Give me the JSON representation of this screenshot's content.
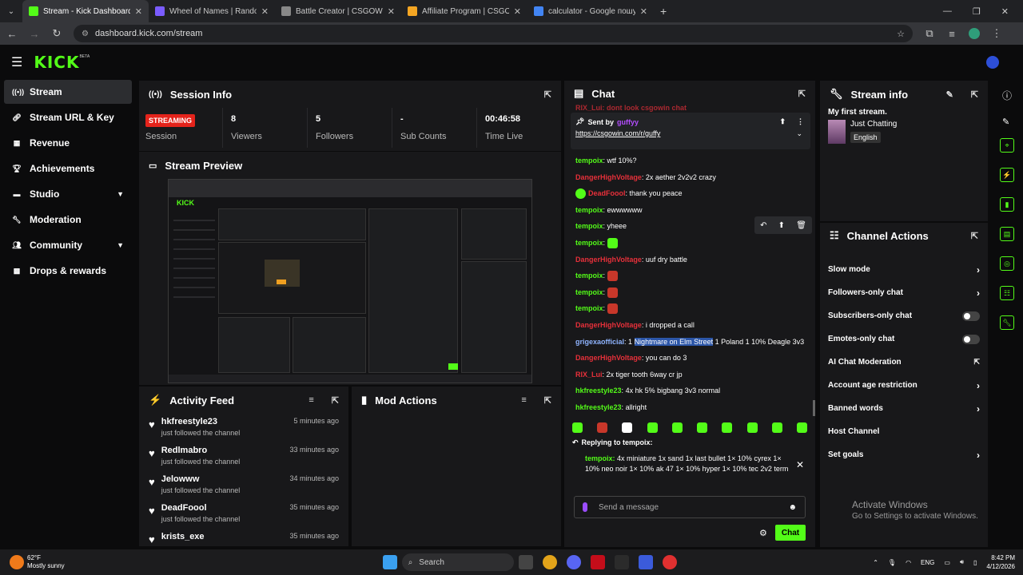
{
  "browser": {
    "tabs": [
      {
        "title": "Stream - Kick Dashboard",
        "active": true,
        "fav": "#53fc18"
      },
      {
        "title": "Wheel of Names | Random nam",
        "active": false,
        "fav": "#7a5cff"
      },
      {
        "title": "Battle Creator | CSGOWIN | De",
        "active": false,
        "fav": "#888888"
      },
      {
        "title": "Affiliate Program | CSGOWIN |",
        "active": false,
        "fav": "#f5a623"
      },
      {
        "title": "calculator - Google пошук",
        "active": false,
        "fav": "#4285f4"
      }
    ],
    "url": "dashboard.kick.com/stream"
  },
  "sidebar": {
    "items": [
      {
        "label": "Stream",
        "icon": "signal-icon"
      },
      {
        "label": "Stream URL & Key",
        "icon": "link-icon"
      },
      {
        "label": "Revenue",
        "icon": "revenue-icon"
      },
      {
        "label": "Achievements",
        "icon": "trophy-icon"
      },
      {
        "label": "Studio",
        "icon": "studio-icon"
      },
      {
        "label": "Moderation",
        "icon": "wrench-icon"
      },
      {
        "label": "Community",
        "icon": "users-icon"
      },
      {
        "label": "Drops & rewards",
        "icon": "gift-icon"
      }
    ]
  },
  "session": {
    "title": "Session Info",
    "badge": "STREAMING",
    "session_label": "Session",
    "stats": [
      {
        "value": "8",
        "label": "Viewers"
      },
      {
        "value": "5",
        "label": "Followers"
      },
      {
        "value": "-",
        "label": "Sub Counts"
      },
      {
        "value": "00:46:58",
        "label": "Time Live"
      }
    ]
  },
  "preview": {
    "title": "Stream Preview"
  },
  "activity": {
    "title": "Activity Feed",
    "items": [
      {
        "name": "hkfreestyle23",
        "sub": "just followed the channel",
        "time": "5 minutes ago"
      },
      {
        "name": "Redlmabro",
        "sub": "just followed the channel",
        "time": "33 minutes ago"
      },
      {
        "name": "Jelowww",
        "sub": "just followed the channel",
        "time": "34 minutes ago"
      },
      {
        "name": "DeadFoool",
        "sub": "just followed the channel",
        "time": "35 minutes ago"
      },
      {
        "name": "krists_exe",
        "sub": "",
        "time": "35 minutes ago"
      }
    ]
  },
  "mod": {
    "title": "Mod Actions"
  },
  "chat": {
    "title": "Chat",
    "cut": "RIX_Lui: dont look csgowin chat",
    "pinned_label": "Sent by",
    "pinned_user": "guffyy",
    "pinned_link": "https://csgowin.com/r/guffy",
    "messages": [
      {
        "user": "tempoix",
        "color": "g",
        "text": "wtf 10%?"
      },
      {
        "user": "DangerHighVoltage",
        "color": "r",
        "text": "2x aether 2v2v2 crazy"
      },
      {
        "user": "DeadFoool",
        "color": "r",
        "text": "thank you peace"
      },
      {
        "user": "tempoix",
        "color": "g",
        "text": "ewwwwww"
      },
      {
        "user": "tempoix",
        "color": "g",
        "text": "yheee"
      },
      {
        "user": "tempoix",
        "color": "g",
        "text": ""
      },
      {
        "user": "DangerHighVoltage",
        "color": "r",
        "text": "uuf dry battle"
      },
      {
        "user": "tempoix",
        "color": "g",
        "text": ""
      },
      {
        "user": "tempoix",
        "color": "g",
        "text": ""
      },
      {
        "user": "tempoix",
        "color": "g",
        "text": ""
      },
      {
        "user": "DangerHighVoltage",
        "color": "r",
        "text": "i dropped a call"
      },
      {
        "user": "grigexaofficial",
        "color": "b",
        "text": "1 Nightmare on Elm Street 1 Poland 1 10% Deagle 3v3"
      },
      {
        "user": "DangerHighVoltage",
        "color": "r",
        "text": "you can do 3"
      },
      {
        "user": "RIX_Lui",
        "color": "r",
        "text": "2x tiger tooth 6way cr jp"
      },
      {
        "user": "hkfreestyle23",
        "color": "g",
        "text": "4x hk 5% bigbang 3v3 normal"
      },
      {
        "user": "hkfreestyle23",
        "color": "g",
        "text": "allright"
      }
    ],
    "reply_label": "Replying to tempoix:",
    "reply_user": "tempoix",
    "reply_text": "4x miniature 1x sand 1x last bullet 1× 10% cyrex 1× 10% neo noir 1× 10% ak 47 1× 10% hyper 1× 10% tec 2v2 term",
    "input_placeholder": "Send a message",
    "send_label": "Chat"
  },
  "streaminfo": {
    "title": "Stream info",
    "name": "My first stream.",
    "category": "Just Chatting",
    "language": "English"
  },
  "channel_actions": {
    "title": "Channel Actions",
    "items": [
      {
        "label": "Slow mode",
        "kind": "arrow"
      },
      {
        "label": "Followers-only chat",
        "kind": "arrow"
      },
      {
        "label": "Subscribers-only chat",
        "kind": "toggle"
      },
      {
        "label": "Emotes-only chat",
        "kind": "toggle"
      },
      {
        "label": "AI Chat Moderation",
        "kind": "ext"
      },
      {
        "label": "Account age restriction",
        "kind": "arrow"
      },
      {
        "label": "Banned words",
        "kind": "arrow"
      },
      {
        "label": "Host Channel",
        "kind": "none"
      },
      {
        "label": "Set goals",
        "kind": "arrow"
      }
    ]
  },
  "watermark": {
    "line1": "Activate Windows",
    "line2": "Go to Settings to activate Windows."
  },
  "taskbar": {
    "temp": "62°F",
    "weather": "Mostly sunny",
    "search": "Search",
    "lang": "ENG",
    "time": "8:42 PM",
    "date": "4/12/2026"
  }
}
